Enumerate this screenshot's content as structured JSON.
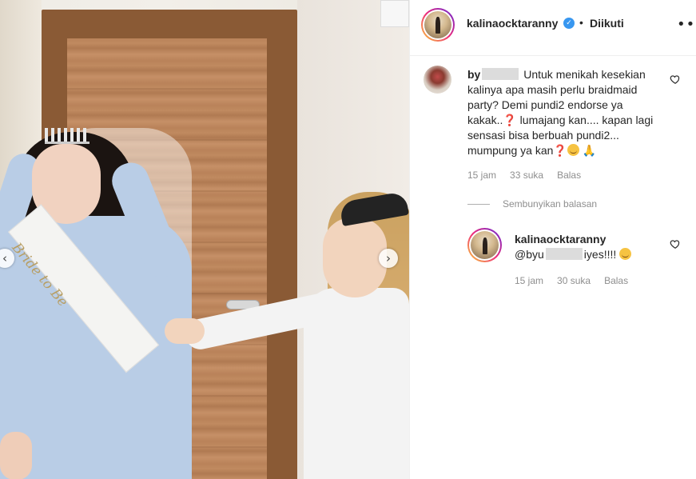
{
  "post": {
    "username": "kalinaocktaranny",
    "follow_separator": "•",
    "follow_status": "Diikuti",
    "more_icon": "more-options-icon"
  },
  "media": {
    "sash_text": "Bride to Be",
    "prev_arrow": "‹",
    "next_arrow": "›"
  },
  "comment": {
    "username_prefix": "by",
    "text_part1": "Untuk menikah kesekian kalinya apa masih perlu braidmaid party? Demi pundi2 endorse ya kakak..",
    "question_mark_1": "❓",
    "text_part2": " lumajang kan.... kapan lagi sensasi bisa berbuah pundi2... mumpung ya kan",
    "question_mark_2": "❓",
    "time": "15 jam",
    "likes": "33 suka",
    "reply_label": "Balas"
  },
  "hide_replies": "Sembunyikan balasan",
  "reply": {
    "username": "kalinaocktaranny",
    "mention_prefix": "@byu",
    "text": "iyes!!!! ",
    "time": "15 jam",
    "likes": "30 suka",
    "reply_label": "Balas"
  },
  "colors": {
    "verified": "#3897f0",
    "meta_gray": "#8e8e8e",
    "text": "#262626"
  }
}
